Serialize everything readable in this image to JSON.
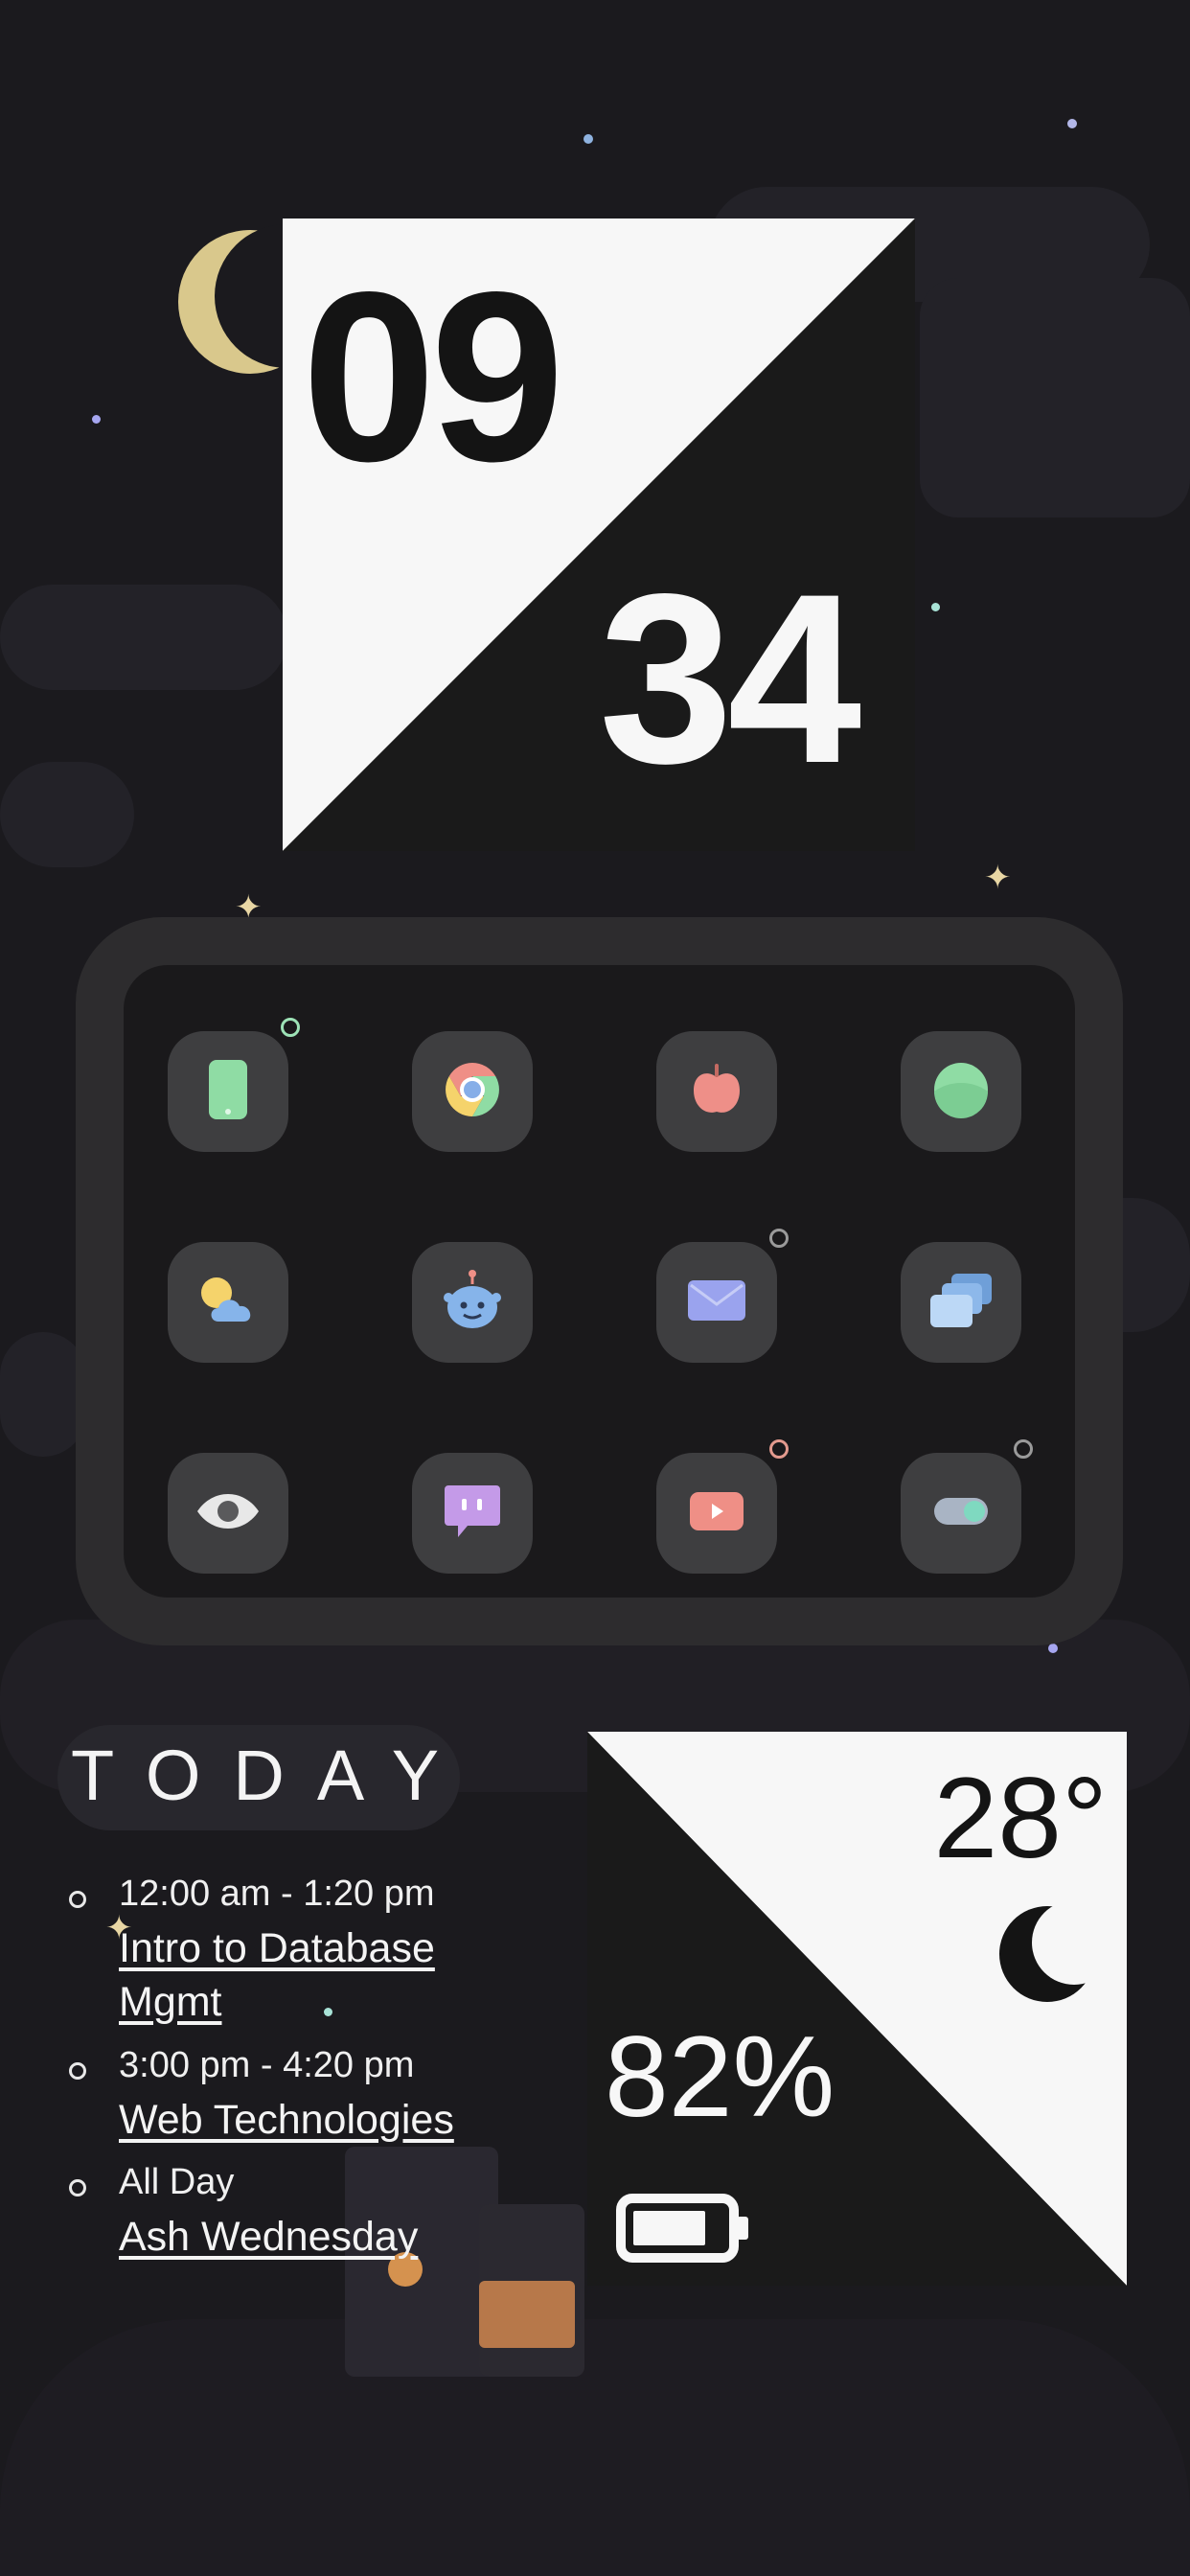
{
  "clock": {
    "hour": "09",
    "minute": "34"
  },
  "apps": [
    {
      "name": "phone",
      "icon": "phone-icon",
      "badge": "#9de2b6"
    },
    {
      "name": "chrome",
      "icon": "chrome-icon",
      "badge": null
    },
    {
      "name": "apple",
      "icon": "apple-icon",
      "badge": null
    },
    {
      "name": "circle-app",
      "icon": "green-circle-icon",
      "badge": null
    },
    {
      "name": "weather",
      "icon": "weather-icon",
      "badge": null
    },
    {
      "name": "reddit",
      "icon": "robot-icon",
      "badge": null
    },
    {
      "name": "mail",
      "icon": "mail-icon",
      "badge": "#9a9a9a"
    },
    {
      "name": "multi-window",
      "icon": "windows-icon",
      "badge": null
    },
    {
      "name": "eye",
      "icon": "eye-icon",
      "badge": null
    },
    {
      "name": "chat",
      "icon": "chat-icon",
      "badge": null
    },
    {
      "name": "video",
      "icon": "play-icon",
      "badge": "#e39a8e"
    },
    {
      "name": "toggle",
      "icon": "toggle-icon",
      "badge": "#9a9a9a"
    }
  ],
  "today": {
    "title": "TODAY",
    "events": [
      {
        "time": "12:00 am - 1:20 pm",
        "title": "Intro to Database Mgmt"
      },
      {
        "time": "3:00 pm - 4:20 pm",
        "title": "Web Technologies"
      },
      {
        "time": "All Day",
        "title": "Ash Wednesday"
      }
    ]
  },
  "weather": {
    "temperature": "28°",
    "condition_icon": "moon-icon"
  },
  "battery": {
    "percent": "82%",
    "level": 0.82
  },
  "colors": {
    "background": "#1b1a1e",
    "light": "#f7f7f7",
    "dark": "#141414",
    "tile": "#3e3e40"
  }
}
